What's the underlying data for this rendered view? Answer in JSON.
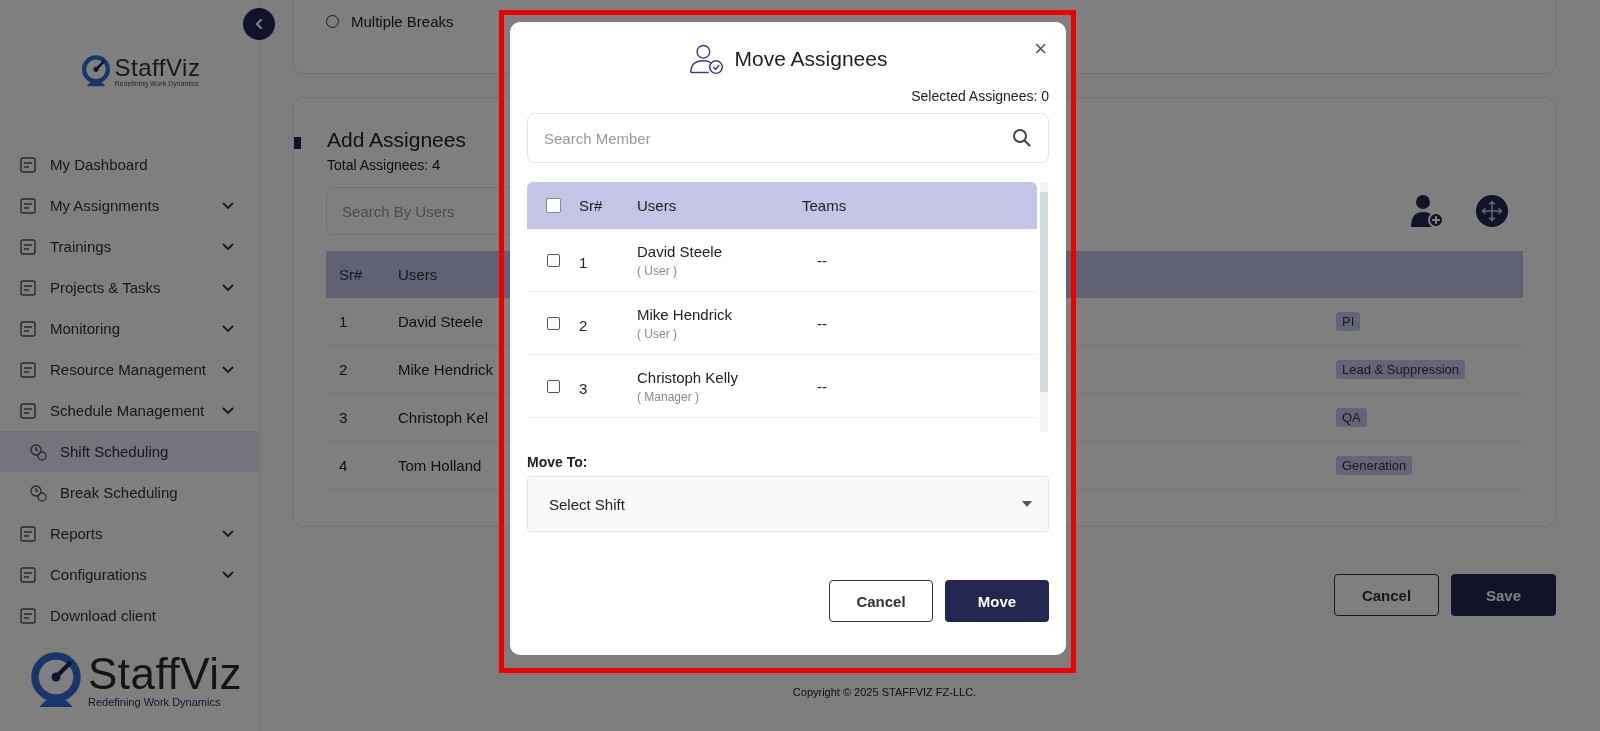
{
  "sidebar": {
    "logo": {
      "name": "StaffViz",
      "tagline": "Redefining Work Dynamics"
    },
    "items": [
      {
        "label": "My Dashboard",
        "expandable": false,
        "selected": false
      },
      {
        "label": "My Assignments",
        "expandable": true,
        "selected": false
      },
      {
        "label": "Trainings",
        "expandable": true,
        "selected": false
      },
      {
        "label": "Projects & Tasks",
        "expandable": true,
        "selected": false
      },
      {
        "label": "Monitoring",
        "expandable": true,
        "selected": false
      },
      {
        "label": "Resource Management",
        "expandable": true,
        "selected": false
      },
      {
        "label": "Schedule Management",
        "expandable": true,
        "selected": false,
        "children": [
          {
            "label": "Shift Scheduling",
            "selected": true
          },
          {
            "label": "Break Scheduling",
            "selected": false
          }
        ]
      },
      {
        "label": "Reports",
        "expandable": true,
        "selected": false
      },
      {
        "label": "Configurations",
        "expandable": true,
        "selected": false
      },
      {
        "label": "Download client",
        "expandable": false,
        "selected": false
      }
    ],
    "bottom_logo": {
      "name": "StaffViz",
      "tagline": "Redefining Work Dynamics"
    }
  },
  "break_option": {
    "label": "Multiple Breaks",
    "selected": false
  },
  "assignees": {
    "title": "Add Assignees",
    "total_label": "Total Assignees:",
    "total": "4",
    "search": {
      "placeholder": "Search By Users"
    },
    "columns": [
      "Sr#",
      "Users"
    ],
    "rows": [
      {
        "sr": "1",
        "user": "David Steele",
        "team": "PI"
      },
      {
        "sr": "2",
        "user": "Mike Hendrick",
        "team": "Lead & Suppression"
      },
      {
        "sr": "3",
        "user": "Christoph Kel",
        "team": "QA"
      },
      {
        "sr": "4",
        "user": "Tom Holland",
        "team": "Generation"
      }
    ]
  },
  "buttons": {
    "cancel": "Cancel",
    "save": "Save"
  },
  "footer": "Copyright © 2025 STAFFVIZ FZ-LLC.",
  "modal": {
    "title": "Move Assignees",
    "close": "×",
    "selected_label": "Selected Assignees: 0",
    "search": {
      "placeholder": "Search Member"
    },
    "all_checked": false,
    "columns": [
      "Sr#",
      "Users",
      "Teams"
    ],
    "rows": [
      {
        "checked": false,
        "sr": "1",
        "name": "David Steele",
        "role": "( User )",
        "team": "--"
      },
      {
        "checked": false,
        "sr": "2",
        "name": "Mike Hendrick",
        "role": "( User )",
        "team": "--"
      },
      {
        "checked": false,
        "sr": "3",
        "name": "Christoph Kelly",
        "role": "( Manager )",
        "team": "--"
      }
    ],
    "move_to_label": "Move To:",
    "select": {
      "placeholder": "Select Shift"
    },
    "cancel": "Cancel",
    "move": "Move"
  }
}
